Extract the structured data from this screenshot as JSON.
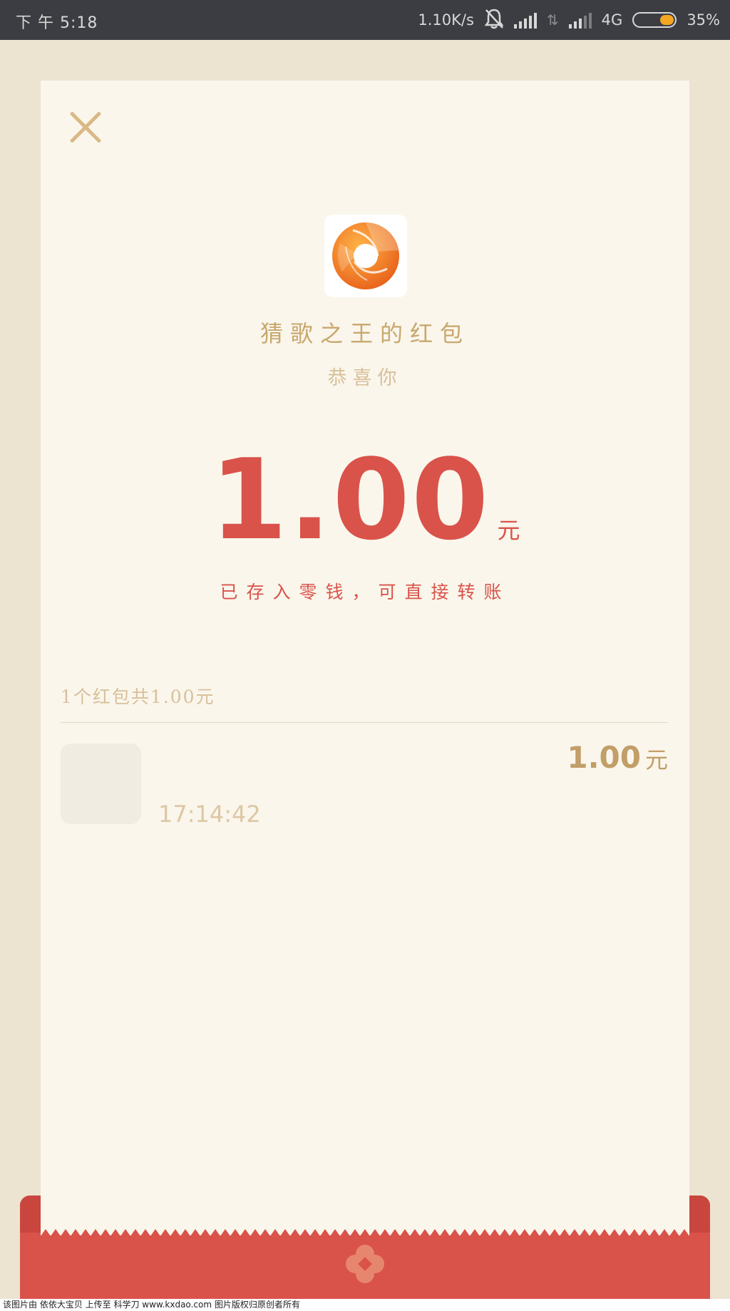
{
  "status_bar": {
    "time": "下 午 5:18",
    "network_speed": "1.10K/s",
    "network_type": "4G",
    "battery_percent": "35%",
    "battery_level": 0.35
  },
  "packet": {
    "sender_title": "猜歌之王的红包",
    "greeting": "恭喜你",
    "amount": "1.00",
    "amount_unit": "元",
    "stored_note": "已存入零钱，可直接转账",
    "summary": "1个红包共1.00元"
  },
  "records": [
    {
      "time": "17:14:42",
      "amount": "1.00",
      "unit": "元"
    }
  ],
  "icons": {
    "close": "close-icon",
    "logo": "aperture-logo-icon",
    "mute": "bell-off-icon",
    "seal": "flower-seal-icon"
  },
  "colors": {
    "accent_red": "#d9534a",
    "gold": "#c9a76d",
    "card_bg": "#faf6ec",
    "page_bg": "#ede3d1",
    "statusbar_bg": "#3b3d42",
    "battery": "#f5a623"
  },
  "footer": {
    "watermark": "该图片由 依依大宝贝 上传至 科学刀 www.kxdao.com 图片版权归原创者所有"
  }
}
